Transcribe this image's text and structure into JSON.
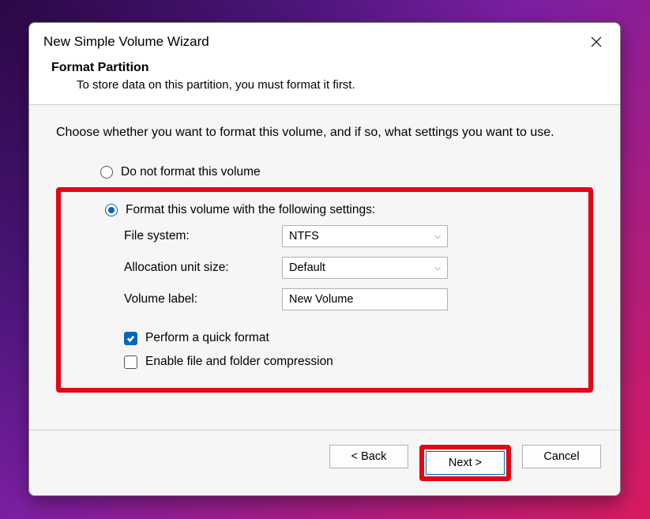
{
  "dialog": {
    "title": "New Simple Volume Wizard",
    "header_title": "Format Partition",
    "header_subtitle": "To store data on this partition, you must format it first.",
    "instruction": "Choose whether you want to format this volume, and if so, what settings you want to use."
  },
  "options": {
    "no_format_label": "Do not format this volume",
    "format_label": "Format this volume with the following settings:",
    "selected": "format"
  },
  "settings": {
    "file_system_label": "File system:",
    "file_system_value": "NTFS",
    "alloc_label": "Allocation unit size:",
    "alloc_value": "Default",
    "volume_label_label": "Volume label:",
    "volume_label_value": "New Volume",
    "quick_format_label": "Perform a quick format",
    "quick_format_checked": true,
    "compression_label": "Enable file and folder compression",
    "compression_checked": false
  },
  "buttons": {
    "back": "< Back",
    "next": "Next >",
    "cancel": "Cancel"
  }
}
